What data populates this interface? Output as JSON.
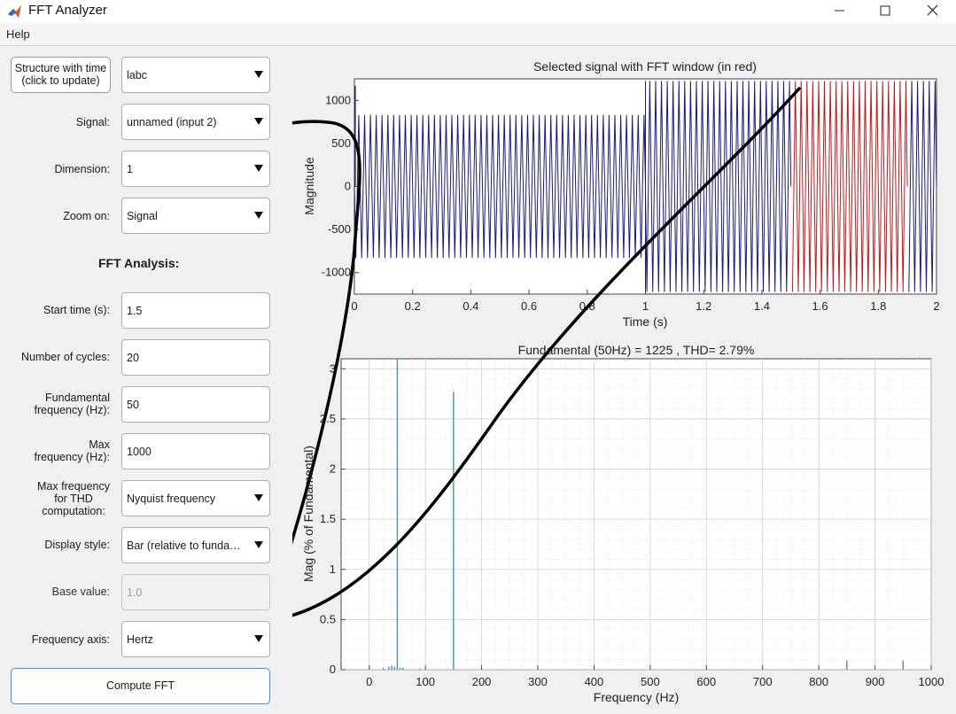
{
  "window": {
    "title": "FFT Analyzer",
    "icon": "matlab-icon",
    "controls": [
      "minimize-icon",
      "maximize-icon",
      "close-icon"
    ]
  },
  "menu": {
    "help_label": "Help"
  },
  "panel": {
    "structure_button_label": "Structure with time\n(click to update)",
    "structure_value": "labc",
    "signal_label": "Signal:",
    "signal_value": "unnamed (input 2)",
    "dimension_label": "Dimension:",
    "dimension_value": "1",
    "zoom_label": "Zoom on:",
    "zoom_value": "Signal",
    "fft_heading": "FFT Analysis:",
    "start_time_label": "Start time (s):",
    "start_time_value": "1.5",
    "cycles_label": "Number of cycles:",
    "cycles_value": "20",
    "fund_freq_label": "Fundamental\nfrequency (Hz):",
    "fund_freq_value": "50",
    "max_freq_label": "Max\nfrequency (Hz):",
    "max_freq_value": "1000",
    "thd_freq_label": "Max frequency\nfor THD\ncomputation:",
    "thd_freq_value": "Nyquist frequency",
    "display_style_label": "Display style:",
    "display_style_value": "Bar (relative to funda…",
    "base_value_label": "Base value:",
    "base_value_placeholder": "1.0",
    "freq_axis_label": "Frequency axis:",
    "freq_axis_value": "Hertz",
    "compute_button_label": "Compute FFT"
  },
  "colors": {
    "signal_line": "#1a1a7a",
    "fft_window": "#c01818",
    "spectrum_bar": "#4a8fbf",
    "annotation_stroke": "#000000"
  },
  "chart_data": [
    {
      "type": "line",
      "title": "Selected signal with FFT window (in red)",
      "xlabel": "Time (s)",
      "ylabel": "Magnitude",
      "xlim": [
        0,
        2
      ],
      "ylim": [
        -1250,
        1250
      ],
      "x_ticks": [
        0,
        0.2,
        0.4,
        0.6,
        0.8,
        1,
        1.2,
        1.4,
        1.6,
        1.8,
        2
      ],
      "x_tick_labels": [
        "0",
        "0.2",
        "0.4",
        "0.6",
        "0.8",
        "1",
        "1.2",
        "1.4",
        "1.6",
        "1.8",
        "2"
      ],
      "y_ticks": [
        -1000,
        -500,
        0,
        500,
        1000
      ],
      "y_tick_labels": [
        "-1000",
        "-500",
        "0",
        "500",
        "1000"
      ],
      "grid": false,
      "series": [
        {
          "frequency_hz": 50,
          "segments": [
            {
              "t_start": 0,
              "t_end": 1,
              "amplitude": 830,
              "initial_peak": 1170
            },
            {
              "t_start": 1,
              "t_end": 2,
              "amplitude": 1225
            }
          ]
        }
      ],
      "fft_window": {
        "t_start": 1.5,
        "t_end": 1.9
      }
    },
    {
      "type": "bar",
      "title": "Fundamental (50Hz) = 1225 , THD= 2.79%",
      "xlabel": "Frequency (Hz)",
      "ylabel": "Mag (% of Fundamental)",
      "xlim": [
        -50,
        1000
      ],
      "ylim": [
        0,
        3.1
      ],
      "x_ticks": [
        0,
        100,
        200,
        300,
        400,
        500,
        600,
        700,
        800,
        900,
        1000
      ],
      "x_tick_labels": [
        "0",
        "100",
        "200",
        "300",
        "400",
        "500",
        "600",
        "700",
        "800",
        "900",
        "1000"
      ],
      "y_ticks": [
        0,
        0.5,
        1,
        1.5,
        2,
        2.5,
        3
      ],
      "y_tick_labels": [
        "0",
        "0.5",
        "1",
        "1.5",
        "2",
        "2.5",
        "3"
      ],
      "grid": true,
      "bars": [
        {
          "x": 25,
          "y": 0.02
        },
        {
          "x": 35,
          "y": 0.03
        },
        {
          "x": 40,
          "y": 0.04
        },
        {
          "x": 45,
          "y": 0.03
        },
        {
          "x": 50,
          "y": 3.1
        },
        {
          "x": 55,
          "y": 0.02
        },
        {
          "x": 60,
          "y": 0.02
        },
        {
          "x": 90,
          "y": 0.01
        },
        {
          "x": 150,
          "y": 2.77
        },
        {
          "x": 850,
          "y": 0.09
        },
        {
          "x": 950,
          "y": 0.09
        }
      ]
    }
  ]
}
